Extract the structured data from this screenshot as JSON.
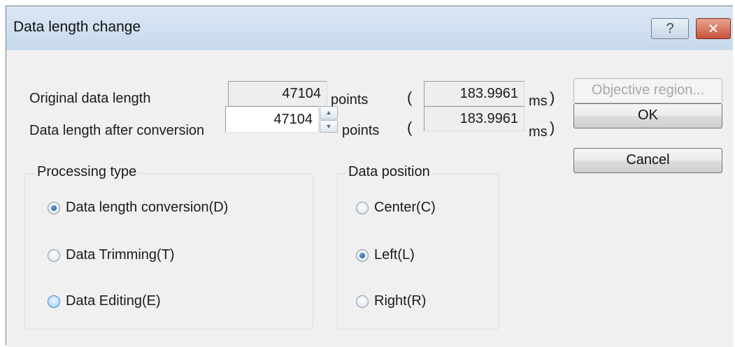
{
  "window": {
    "title": "Data length change",
    "help_icon": "question-mark-icon",
    "close_icon": "close-x-icon"
  },
  "original": {
    "label": "Original data length",
    "points_value": "47104",
    "points_unit": "points",
    "ms_value": "183.9961",
    "ms_unit": "ms"
  },
  "converted": {
    "label": "Data length after conversion",
    "points_value": "47104",
    "points_unit": "points",
    "ms_value": "183.9961",
    "ms_unit": "ms"
  },
  "paren_open": "(",
  "paren_close": ")",
  "buttons": {
    "objective": "Objective region...",
    "ok": "OK",
    "cancel": "Cancel"
  },
  "processing_type": {
    "title": "Processing type",
    "options": [
      {
        "label": "Data length conversion(D)",
        "checked": true
      },
      {
        "label": "Data Trimming(T)",
        "checked": false
      },
      {
        "label": "Data Editing(E)",
        "checked": false
      }
    ]
  },
  "data_position": {
    "title": "Data position",
    "options": [
      {
        "label": "Center(C)",
        "checked": false
      },
      {
        "label": "Left(L)",
        "checked": true
      },
      {
        "label": "Right(R)",
        "checked": false
      }
    ]
  },
  "colors": {
    "titlebar": "#c7d9ee",
    "close_button": "#c8523a",
    "dialog_background": "#f0f0f0",
    "radio_selected": "#1e4f9a"
  }
}
